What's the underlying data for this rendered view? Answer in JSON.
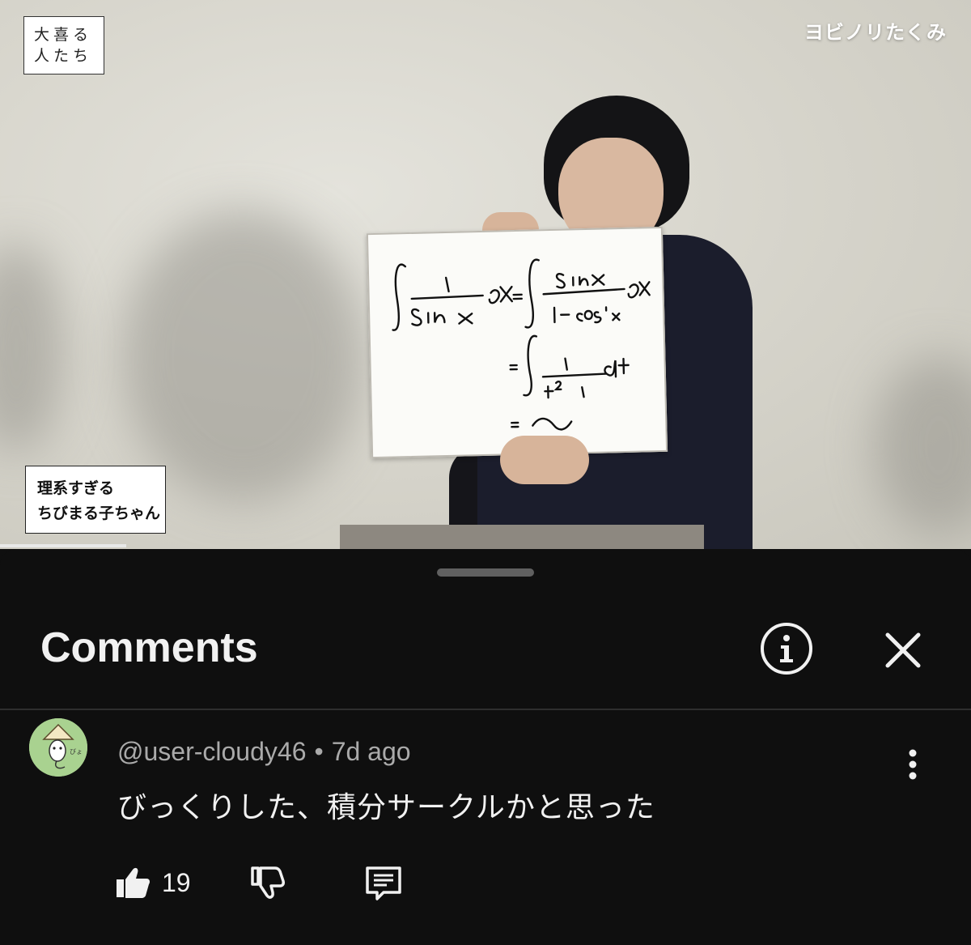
{
  "video": {
    "channel_watermark": "ヨビノリたくみ",
    "logo_line1": "大喜る",
    "logo_line2": "人たち",
    "caption_line1": "理系すぎる",
    "caption_line2": "ちびまる子ちゃん",
    "progress_fraction": 0.13
  },
  "comments_panel": {
    "title": "Comments",
    "info_icon": "info-icon",
    "close_icon": "close-icon",
    "comments": [
      {
        "author": "@user-cloudy46",
        "separator": "•",
        "time": "7d ago",
        "text": "びっくりした、積分サークルかと思った",
        "likes": "19",
        "menu_icon": "more-vert-icon",
        "like_icon": "thumbs-up-icon",
        "dislike_icon": "thumbs-down-icon",
        "reply_icon": "reply-icon"
      }
    ]
  }
}
